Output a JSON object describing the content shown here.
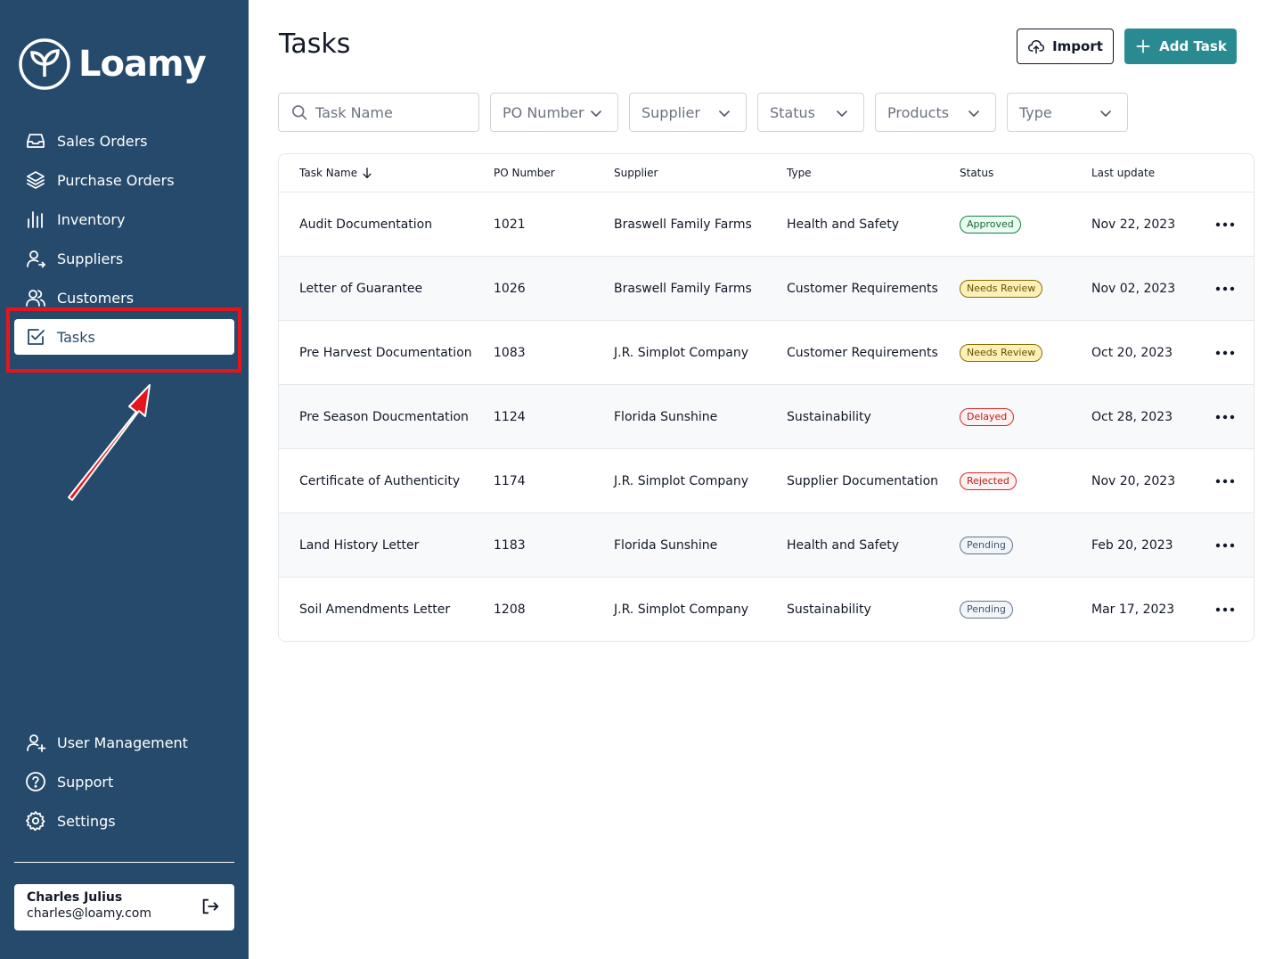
{
  "app": {
    "name": "Loamy"
  },
  "sidebar": {
    "items": [
      {
        "label": "Sales Orders",
        "icon": "inbox-icon"
      },
      {
        "label": "Purchase Orders",
        "icon": "layers-icon"
      },
      {
        "label": "Inventory",
        "icon": "bar-chart-icon"
      },
      {
        "label": "Suppliers",
        "icon": "user-arrow-icon"
      },
      {
        "label": "Customers",
        "icon": "users-icon"
      },
      {
        "label": "Tasks",
        "icon": "checkbox-icon",
        "active": true
      }
    ],
    "bottom_items": [
      {
        "label": "User Management",
        "icon": "user-plus-icon"
      },
      {
        "label": "Support",
        "icon": "help-circle-icon"
      },
      {
        "label": "Settings",
        "icon": "gear-icon"
      }
    ],
    "user": {
      "name": "Charles Julius",
      "email": "charles@loamy.com"
    }
  },
  "page": {
    "title": "Tasks",
    "import_label": "Import",
    "add_label": "Add Task"
  },
  "filters": {
    "search_placeholder": "Task Name",
    "po_number": "PO Number",
    "supplier": "Supplier",
    "status": "Status",
    "products": "Products",
    "type": "Type"
  },
  "table": {
    "columns": [
      "Task Name",
      "PO Number",
      "Supplier",
      "Type",
      "Status",
      "Last update"
    ],
    "rows": [
      {
        "name": "Audit Documentation",
        "po": "1021",
        "supplier": "Braswell Family Farms",
        "type": "Health and Safety",
        "status": "Approved",
        "updated": "Nov 22, 2023"
      },
      {
        "name": "Letter of Guarantee",
        "po": "1026",
        "supplier": "Braswell Family Farms",
        "type": "Customer Requirements",
        "status": "Needs Review",
        "updated": "Nov 02, 2023"
      },
      {
        "name": "Pre Harvest Documentation",
        "po": "1083",
        "supplier": "J.R. Simplot Company",
        "type": "Customer Requirements",
        "status": "Needs Review",
        "updated": "Oct 20, 2023"
      },
      {
        "name": "Pre Season Doucmentation",
        "po": "1124",
        "supplier": "Florida Sunshine",
        "type": "Sustainability",
        "status": "Delayed",
        "updated": "Oct 28, 2023"
      },
      {
        "name": "Certificate of Authenticity",
        "po": "1174",
        "supplier": "J.R. Simplot Company",
        "type": "Supplier Documentation",
        "status": "Rejected",
        "updated": "Nov 20, 2023"
      },
      {
        "name": "Land History Letter",
        "po": "1183",
        "supplier": "Florida Sunshine",
        "type": "Health and Safety",
        "status": "Pending",
        "updated": "Feb 20, 2023"
      },
      {
        "name": "Soil Amendments Letter",
        "po": "1208",
        "supplier": "J.R. Simplot Company",
        "type": "Sustainability",
        "status": "Pending",
        "updated": "Mar 17, 2023"
      }
    ]
  },
  "colors": {
    "sidebar_bg": "#264a6b",
    "accent": "#2a8a92",
    "highlight": "#e8141b",
    "status": {
      "Approved": {
        "text": "#166534",
        "border": "#15803d",
        "bg": "#ecfdf3"
      },
      "Needs Review": {
        "text": "#6b4f00",
        "border": "#8a6d00",
        "bg": "#fdf1b8"
      },
      "Delayed": {
        "text": "#b91c1c",
        "border": "#dc2626",
        "bg": "#fef2f2"
      },
      "Rejected": {
        "text": "#b91c1c",
        "border": "#dc2626",
        "bg": "#fef2f2"
      },
      "Pending": {
        "text": "#475569",
        "border": "#64748b",
        "bg": "#f1f5f9"
      }
    }
  }
}
